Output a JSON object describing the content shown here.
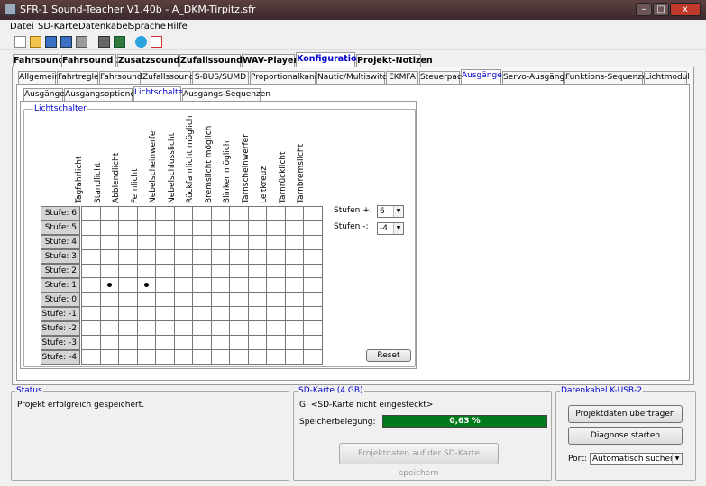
{
  "window": {
    "title": "SFR-1 Sound-Teacher V1.40b - A_DKM-Tirpitz.sfr",
    "minimize": "–",
    "maximize": "□",
    "close": "x"
  },
  "menu": [
    "Datei",
    "SD-Karte",
    "Datenkabel",
    "Sprache",
    "Hilfe"
  ],
  "toolbar_icons": [
    "new-file-icon",
    "open-folder-icon",
    "save-icon",
    "save-as-icon",
    "print-icon",
    "grid-icon",
    "cable-icon",
    "note-icon",
    "document-icon"
  ],
  "main_tabs": [
    "Fahrsound",
    "Fahrsound 2",
    "Zusatzsounds",
    "Zufallssounds",
    "WAV-Player",
    "Konfiguration",
    "Projekt-Notizen"
  ],
  "config_tabs": [
    "Allgemein",
    "Fahrtregler",
    "Fahrsound",
    "Zufallssound",
    "S-BUS/SUMD",
    "Proportionalkanäle",
    "Nautic/Multiswitch",
    "EKMFA",
    "Steuerpad",
    "Ausgänge",
    "Servo-Ausgänge",
    "Funktions-Sequenzen",
    "Lichtmodul"
  ],
  "output_tabs": [
    "Ausgänge",
    "Ausgangsoptionen",
    "Lichtschalter",
    "Ausgangs-Sequenzen"
  ],
  "lichtschalter": {
    "group_label": "Lichtschalter",
    "columns": [
      "Tagfahrlicht",
      "Standlicht",
      "Abblendlicht",
      "Fernlicht",
      "Nebelscheinwerfer",
      "Nebelschlusslicht",
      "Rückfahrlicht möglich",
      "Bremslicht möglich",
      "Blinker möglich",
      "Tarnscheinwerfer",
      "Leitkreuz",
      "Tarnrücklicht",
      "Tarnbremslicht"
    ],
    "rows": [
      "Stufe: 6",
      "Stufe: 5",
      "Stufe: 4",
      "Stufe: 3",
      "Stufe: 2",
      "Stufe: 1",
      "Stufe: 0",
      "Stufe: -1",
      "Stufe: -2",
      "Stufe: -3",
      "Stufe: -4"
    ],
    "checked_cells": [
      {
        "row": 5,
        "col": 1
      },
      {
        "row": 5,
        "col": 3
      }
    ],
    "stufen_plus_label": "Stufen +:",
    "stufen_plus_value": "6",
    "stufen_minus_label": "Stufen -:",
    "stufen_minus_value": "-4",
    "reset_label": "Reset"
  },
  "status": {
    "label": "Status",
    "text": "Projekt erfolgreich gespeichert."
  },
  "sdcard": {
    "label": "SD-Karte (4 GB)",
    "drive_text": "G: <SD-Karte nicht eingesteckt>",
    "usage_label": "Speicherbelegung:",
    "usage_value": "0,63 %",
    "usage_percent": 0.63,
    "save_button": "Projektdaten auf der SD-Karte speichern"
  },
  "cable": {
    "label": "Datenkabel K-USB-2",
    "transfer_button": "Projektdaten übertragen",
    "diagnose_button": "Diagnose starten",
    "port_label": "Port:",
    "port_value": "Automatisch suchen"
  },
  "colors": {
    "progress_green": "#007a1a",
    "active_tab_text": "#0000cc",
    "titlebar": "#4a3336"
  }
}
